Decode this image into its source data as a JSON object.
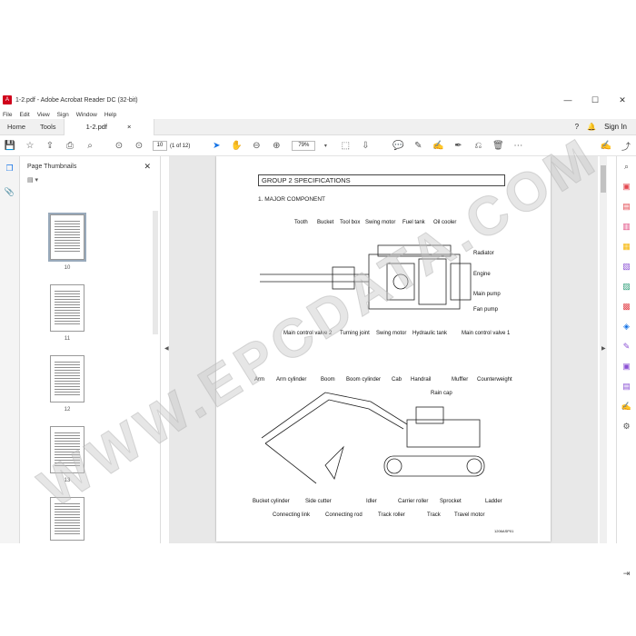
{
  "window": {
    "title": "1-2.pdf - Adobe Acrobat Reader DC (32-bit)",
    "minimize": "—",
    "maximize": "☐",
    "close": "✕"
  },
  "menu": [
    "File",
    "Edit",
    "View",
    "Sign",
    "Window",
    "Help"
  ],
  "tabs": {
    "home": "Home",
    "tools": "Tools",
    "doc": "1-2.pdf",
    "doc_close": "×",
    "sign_in": "Sign In"
  },
  "toolbar": {
    "page_value": "10",
    "page_count": "(1 of 12)",
    "zoom": "79%"
  },
  "thumbpanel": {
    "title": "Page Thumbnails",
    "pages": [
      "10",
      "11",
      "12",
      "13"
    ]
  },
  "doc": {
    "heading": "GROUP  2  SPECIFICATIONS",
    "subheading": "1.  MAJOR COMPONENT",
    "top_labels": [
      "Tooth",
      "Bucket",
      "Tool box",
      "Swing motor",
      "Fuel tank",
      "Oil cooler",
      "Radiator",
      "Engine",
      "Main pump",
      "Fan pump",
      "Main control valve 2",
      "Turning joint",
      "Swing motor",
      "Hydraulic tank",
      "Main control valve 1"
    ],
    "side_labels": [
      "Arm",
      "Arm cylinder",
      "Boom",
      "Boom cylinder",
      "Cab",
      "Handrail",
      "Muffler",
      "Counterweight",
      "Rain cap",
      "Bucket cylinder",
      "Side cutter",
      "Idler",
      "Carrier roller",
      "Sprocket",
      "Ladder",
      "Connecting link",
      "Connecting rod",
      "Track roller",
      "Track",
      "Travel motor"
    ],
    "figure_code": "1206ASP01"
  },
  "watermark": "WWW.EPCDATA.COM",
  "colors": {
    "accent": "#1473e6",
    "pdf_red": "#d0021b"
  }
}
